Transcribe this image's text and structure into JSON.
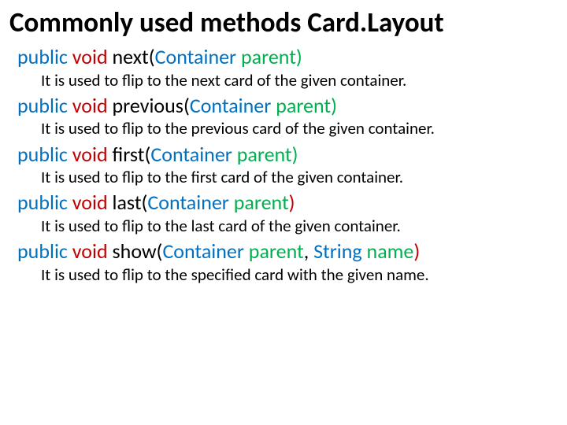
{
  "title": "Commonly used methods Card.Layout",
  "methods": [
    {
      "public": "public ",
      "void": "void ",
      "name": "next(",
      "type": "Container ",
      "param": "parent",
      "close": ")",
      "desc": "It is used to flip to the next card of the given container."
    },
    {
      "public": "public ",
      "void": "void ",
      "name": "previous(",
      "type": "Container ",
      "param": "parent",
      "close": ")",
      "desc": "It is used to flip to the previous card of the given container."
    },
    {
      "public": "public ",
      "void": "void ",
      "name": "first(",
      "type": "Container ",
      "param": "parent",
      "close": ")",
      "desc": "It is used to flip to the first card of the given container."
    },
    {
      "public": "public ",
      "void": "void ",
      "name": "last(",
      "type": "Container ",
      "param": "parent",
      "close": ")",
      "desc": "It is used to flip to the last card of the given container."
    },
    {
      "public": "public ",
      "void": "void ",
      "name": "show(",
      "type": "Container ",
      "param": "parent",
      "comma": ", ",
      "type2": "String ",
      "param2": "name",
      "close": ")",
      "desc": "It is used to flip to the specified card with the given name."
    }
  ]
}
